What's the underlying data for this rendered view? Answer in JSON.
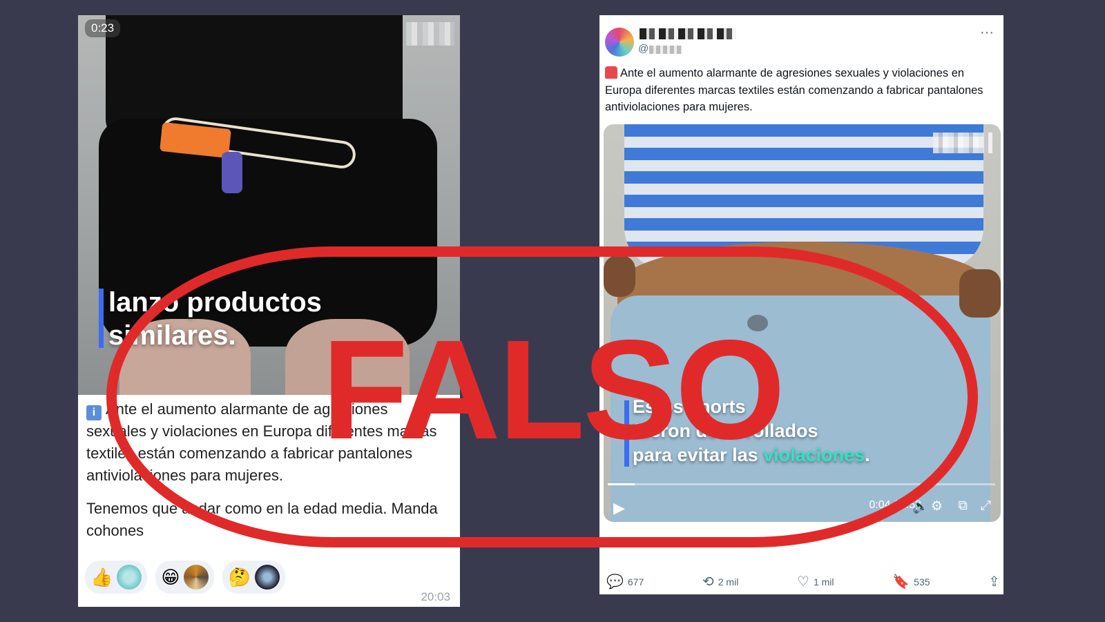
{
  "left_post": {
    "timer": "0:23",
    "video_caption": [
      "lanzó productos",
      "similares."
    ],
    "message_paragraphs": [
      "Ante el aumento alarmante de agresiones sexuales y violaciones en Europa diferentes marcas textiles están comenzando a fabricar pantalones antiviolaciones para mujeres.",
      "Tenemos que andar como en la edad media. Manda cohones"
    ],
    "info_icon": "info-icon",
    "reactions": [
      {
        "emoji": "👍",
        "icon": "thumbs-up"
      },
      {
        "emoji": "😁",
        "icon": "grinning-face"
      },
      {
        "emoji": "🤔",
        "icon": "thinking-face"
      }
    ],
    "time": "20:03"
  },
  "right_post": {
    "handle_prefix": "@",
    "more_label": "···",
    "text": "Ante el aumento alarmante de agresiones sexuales y violaciones en Europa diferentes marcas textiles están comenzando a fabricar pantalones antiviolaciones para mujeres.",
    "video": {
      "caption_line1": "Estos shorts",
      "caption_line2": "fueron desarrollados",
      "caption_line3_plain": "para evitar las",
      "caption_line3_highlight": "violaciones",
      "caption_line3_end": ".",
      "time": "0:04 / 0:58",
      "progress_fraction": 0.069
    },
    "actions": {
      "replies": "677",
      "reposts": "2 mil",
      "likes": "1 mil",
      "bookmarks": "535"
    }
  },
  "stamp": {
    "label": "FALSO",
    "color": "#e02a2a"
  }
}
